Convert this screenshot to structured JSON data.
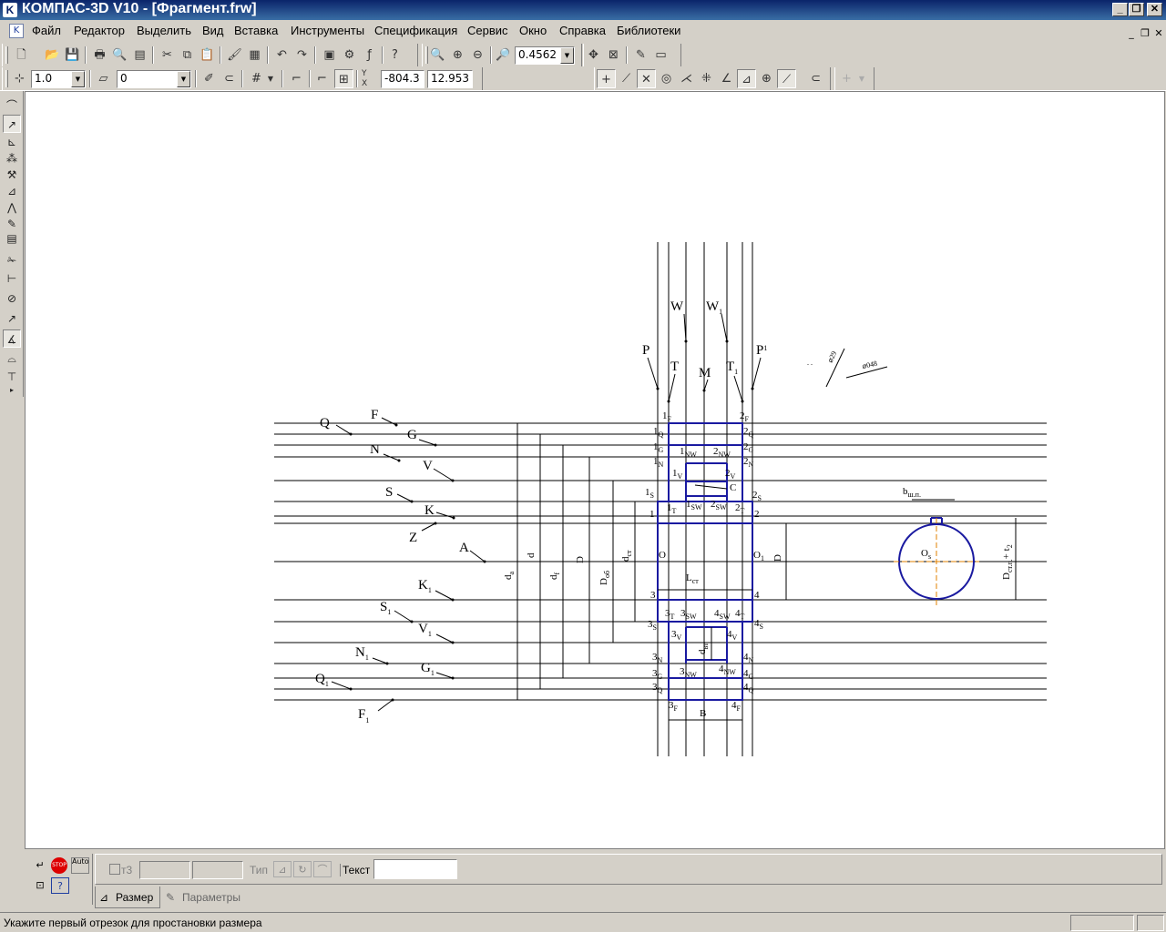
{
  "window": {
    "title": "КОМПАС-3D V10 - [Фрагмент.frw]",
    "icon": "K",
    "min": "_",
    "max": "❐",
    "close": "✕"
  },
  "menu": [
    "Файл",
    "Редактор",
    "Выделить",
    "Вид",
    "Вставка",
    "Инструменты",
    "Спецификация",
    "Сервис",
    "Окно",
    "Справка",
    "Библиотеки"
  ],
  "toolbar1": {
    "zoom_value": "0.4562"
  },
  "toolbar2": {
    "line_width": "1.0",
    "layer": "0",
    "coord_x": "-804.3",
    "coord_y": "12.953",
    "y_label": "Y",
    "x_label": "X"
  },
  "drawing": {
    "left_labels": [
      {
        "t": "Q",
        "s": ""
      },
      {
        "t": "F",
        "s": ""
      },
      {
        "t": "G",
        "s": ""
      },
      {
        "t": "N",
        "s": ""
      },
      {
        "t": "V",
        "s": ""
      },
      {
        "t": "S",
        "s": ""
      },
      {
        "t": "K",
        "s": ""
      },
      {
        "t": "Z",
        "s": ""
      },
      {
        "t": "A",
        "s": ""
      },
      {
        "t": "K",
        "s": "1"
      },
      {
        "t": "S",
        "s": "1"
      },
      {
        "t": "V",
        "s": "1"
      },
      {
        "t": "N",
        "s": "1"
      },
      {
        "t": "G",
        "s": "1"
      },
      {
        "t": "Q",
        "s": "1"
      },
      {
        "t": "F",
        "s": "1"
      }
    ],
    "top_labels": [
      {
        "t": "P",
        "s": ""
      },
      {
        "t": "W",
        "s": ""
      },
      {
        "t": "T",
        "s": ""
      },
      {
        "t": "M",
        "s": ""
      },
      {
        "t": "W",
        "s": "1"
      },
      {
        "t": "T",
        "s": "1"
      },
      {
        "t": "P",
        "s": "1"
      }
    ],
    "dims": [
      "d",
      "d",
      "d",
      "D",
      "D",
      "d",
      "D",
      "L",
      "d",
      "D",
      "B",
      "b",
      "D",
      "C",
      "O",
      "O",
      "O"
    ],
    "dim_subs": [
      "a",
      "f",
      "",
      "об",
      "ст",
      "ст.",
      "",
      "ст",
      "вт",
      "",
      "",
      "ш.п.",
      "ст.п.",
      "",
      "",
      "1",
      "s"
    ],
    "t2_label": "+ t",
    "t2_sub": "2",
    "phi1": "⌀29",
    "phi2": "⌀048",
    "dots": ". ."
  },
  "panel": {
    "enter_icon": "↵",
    "stop": "STOP",
    "auto": "Auto",
    "t3_label": "т3",
    "type_label": "Тип",
    "text_label": "Текст",
    "text_value": "",
    "tab_size": "Размер",
    "tab_params": "Параметры"
  },
  "status": {
    "message": "Укажите первый отрезок для простановки размера"
  }
}
